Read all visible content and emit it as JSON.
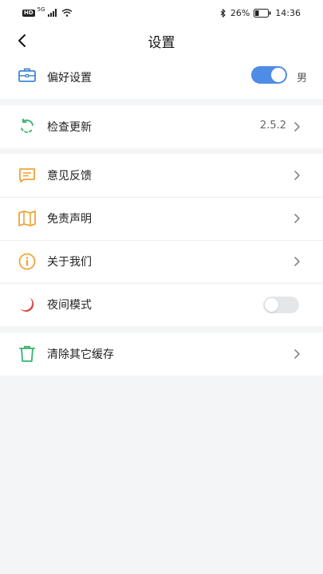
{
  "status_bar": {
    "badge": "HD",
    "network": "5G",
    "battery_percent": "26%",
    "time": "14:36"
  },
  "header": {
    "title": "设置"
  },
  "preferences": {
    "label": "偏好设置",
    "toggle_on": true,
    "gender": "男"
  },
  "update": {
    "label": "检查更新",
    "version": "2.5.2"
  },
  "menu": {
    "feedback": "意见反馈",
    "disclaimer": "免责声明",
    "about": "关于我们",
    "night_mode": "夜间模式",
    "night_mode_on": false
  },
  "cache": {
    "label": "清除其它缓存"
  },
  "colors": {
    "toggle_on": "#4f8ce5",
    "icon_blue": "#3f88d6",
    "icon_green": "#36b46a",
    "icon_orange": "#f0a43a",
    "icon_red": "#e0493f"
  }
}
